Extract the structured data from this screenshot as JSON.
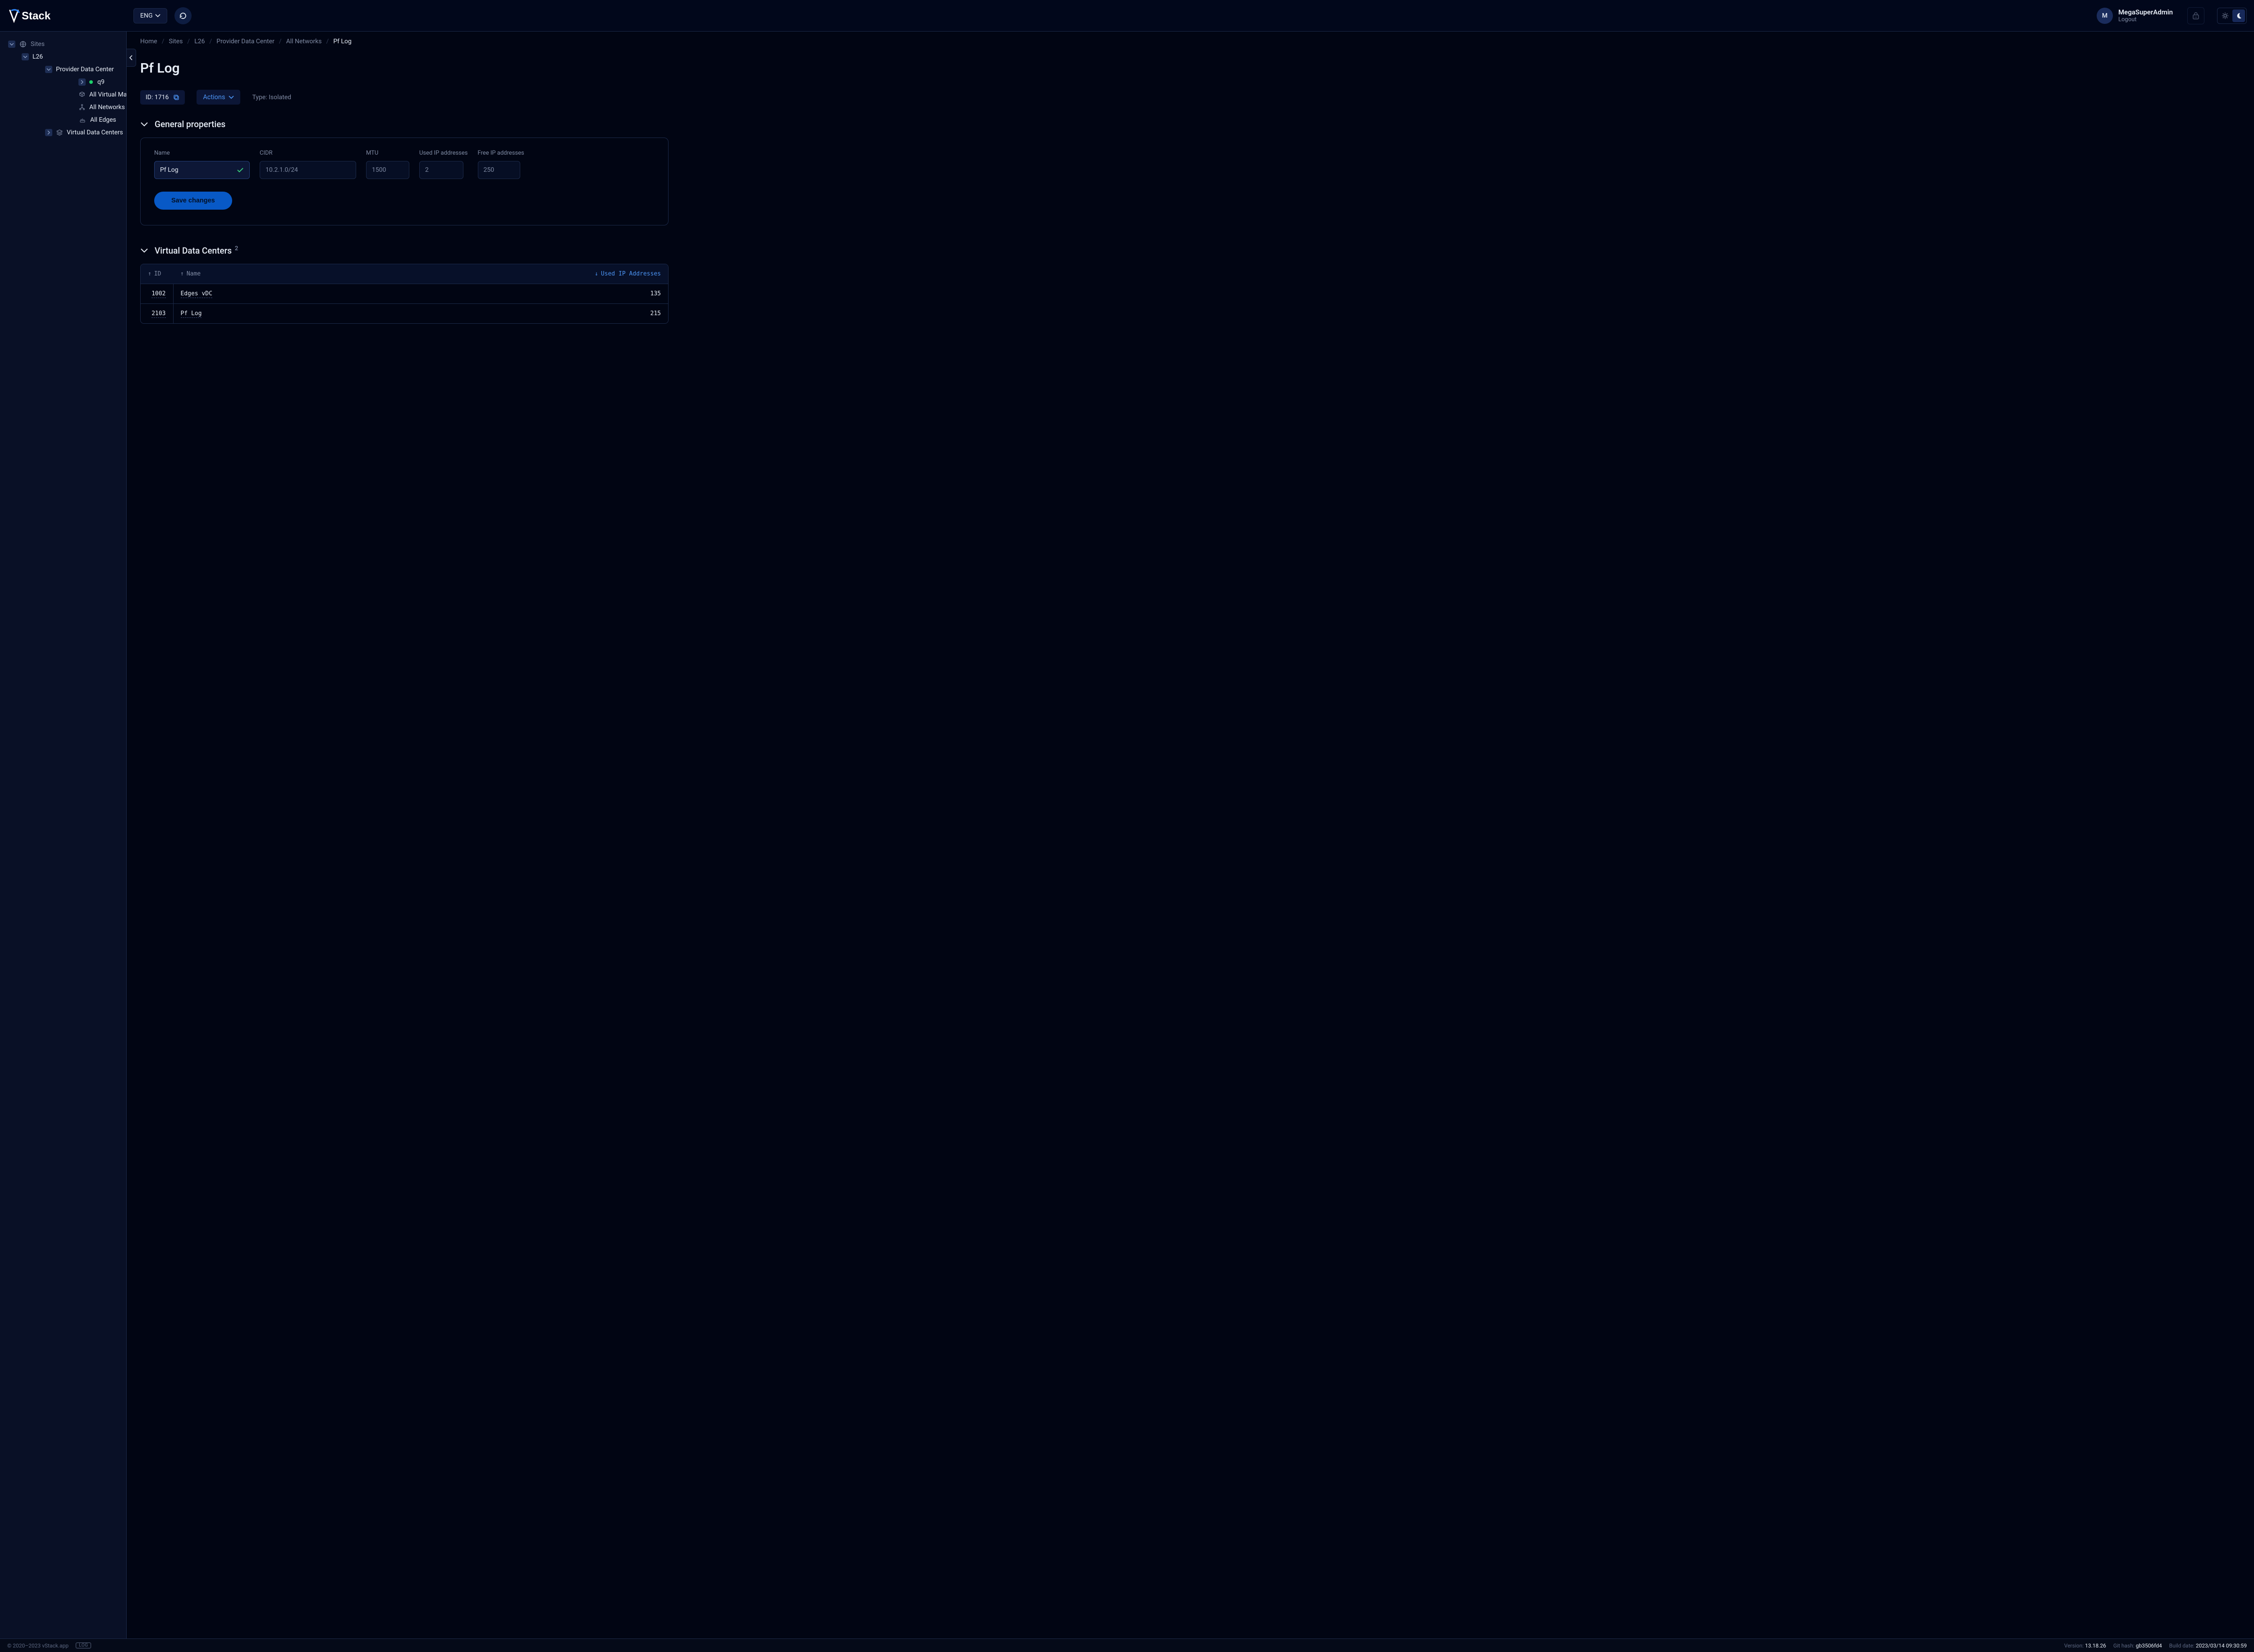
{
  "header": {
    "logo_text": "Stack",
    "lang": "ENG",
    "user": {
      "initial": "M",
      "name": "MegaSuperAdmin",
      "logout": "Logout"
    }
  },
  "sidebar": {
    "root": "Sites",
    "site": "L26",
    "dc": "Provider Data Center",
    "cluster": "q9",
    "vm": "All Virtual Machines",
    "nets": "All Networks",
    "edges": "All Edges",
    "vdc": "Virtual Data Centers"
  },
  "breadcrumb": [
    "Home",
    "Sites",
    "L26",
    "Provider Data Center",
    "All Networks",
    "Pf Log"
  ],
  "page": {
    "title": "Pf Log",
    "id_label": "ID: 1716",
    "actions": "Actions",
    "type": "Type: Isolated",
    "gp_title": "General properties",
    "fields": {
      "name_label": "Name",
      "name_value": "Pf Log",
      "cidr_label": "CIDR",
      "cidr_value": "10.2.1.0/24",
      "mtu_label": "MTU",
      "mtu_value": "1500",
      "used_label": "Used IP addresses",
      "used_value": "2",
      "free_label": "Free IP addresses",
      "free_value": "250"
    },
    "save": "Save changes",
    "vdc_title": "Virtual Data Centers",
    "vdc_count": "2",
    "table": {
      "h_id": "ID",
      "h_name": "Name",
      "h_used": "Used IP Addresses",
      "rows": [
        {
          "id": "1002",
          "name": "Edges vDC",
          "used": "135"
        },
        {
          "id": "2103",
          "name": "Pf Log",
          "used": "215"
        }
      ]
    }
  },
  "footer": {
    "copyright": "© 2020–2023 vStack.app",
    "log": "LOG",
    "version_l": "Version:",
    "version_v": "13.18.26",
    "git_l": "Git hash:",
    "git_v": "gb3506fd4",
    "build_l": "Build date:",
    "build_v": "2023/03/14 09:30:59"
  }
}
